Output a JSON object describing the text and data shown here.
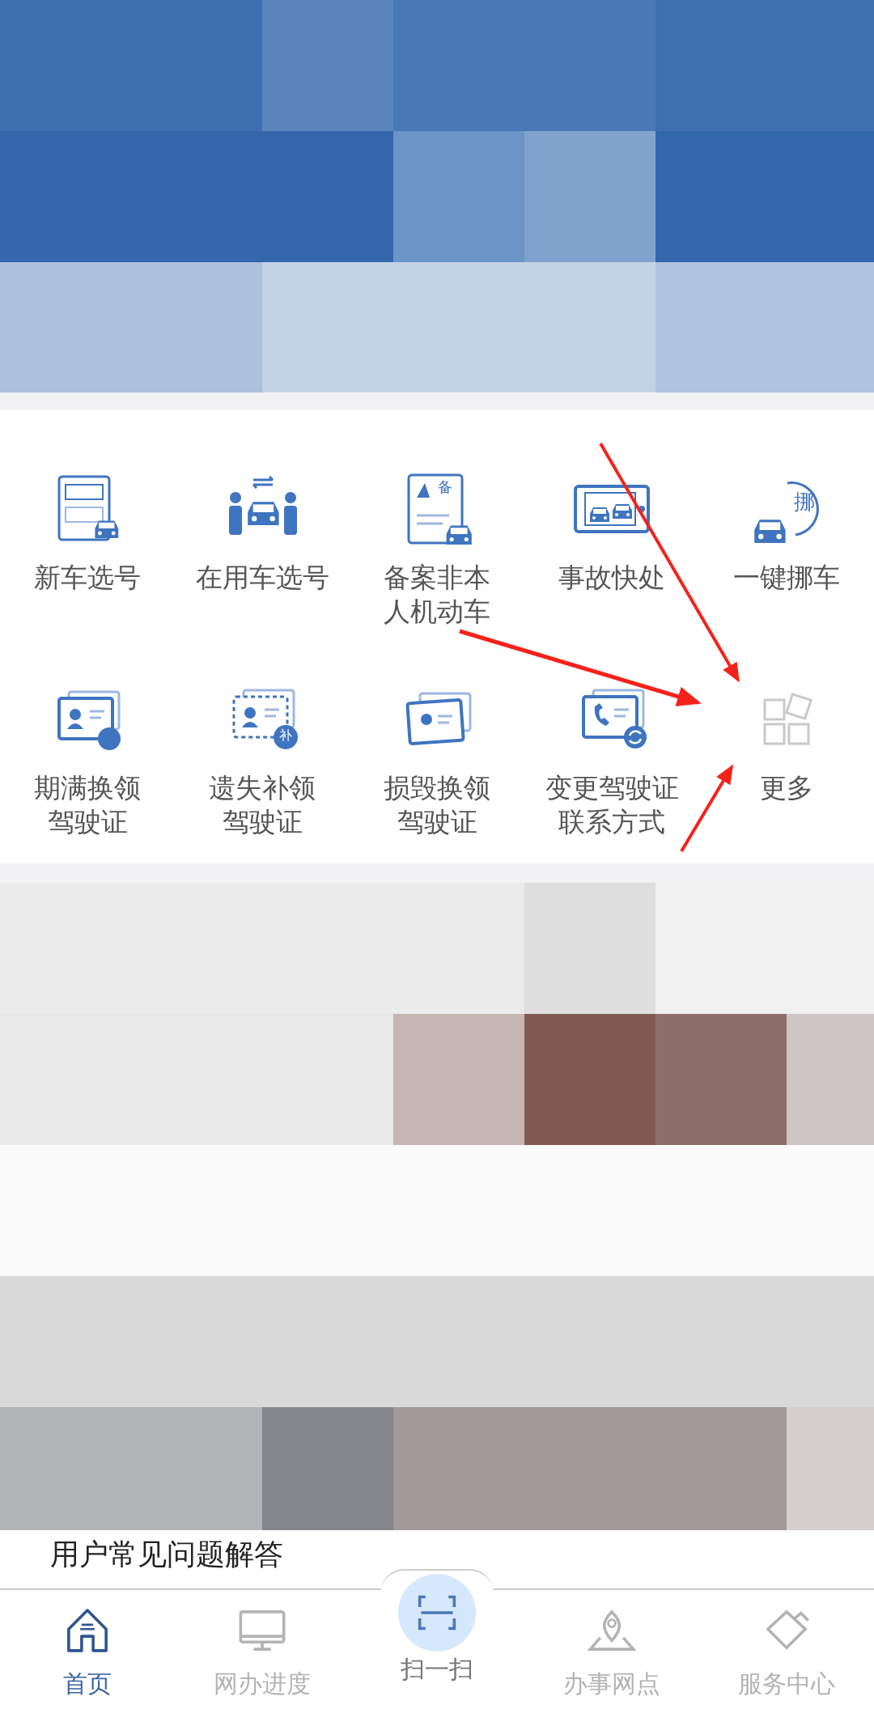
{
  "services": [
    {
      "label": "新车选号"
    },
    {
      "label": "在用车选号"
    },
    {
      "label": "备案非本人机动车",
      "badge": "备"
    },
    {
      "label": "事故快处"
    },
    {
      "label": "一键挪车",
      "badge": "挪"
    },
    {
      "label": "期满换领驾驶证"
    },
    {
      "label": "遗失补领驾驶证",
      "badge": "补"
    },
    {
      "label": "损毁换领驾驶证"
    },
    {
      "label": "变更驾驶证联系方式"
    },
    {
      "label": "更多"
    }
  ],
  "section_title": "用户常见问题解答",
  "tabs": [
    {
      "label": "首页",
      "selected": true
    },
    {
      "label": "网办进度",
      "selected": false
    },
    {
      "label": "扫一扫",
      "selected": false
    },
    {
      "label": "办事网点",
      "selected": false
    },
    {
      "label": "服务中心",
      "selected": false
    }
  ]
}
